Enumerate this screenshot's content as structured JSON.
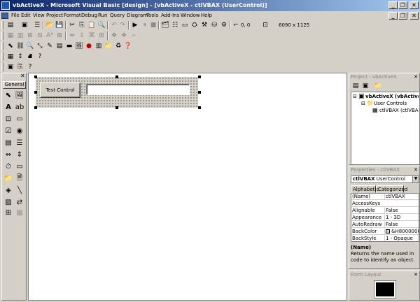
{
  "window": {
    "title": "vbActiveX - Microsoft Visual Basic [design] - [vbActiveX - ctlVBAX (UserControl)]",
    "minimize": "_",
    "restore": "❐",
    "close": "✕"
  },
  "menu": [
    "File",
    "Edit",
    "View",
    "Project",
    "Format",
    "Debug",
    "Run",
    "Query",
    "Diagram",
    "Tools",
    "Add-Ins",
    "Window",
    "Help"
  ],
  "toolbar": {
    "position": "0, 0",
    "size": "6090 x 1125"
  },
  "toolbox": {
    "tab": "General"
  },
  "design": {
    "button_label": "Test Control"
  },
  "project": {
    "title": "Project - vbActiveX",
    "root": "vbActiveX (vbActiveX.vbp)",
    "folder": "User Controls",
    "item": "ctlVBAX (ctlVBAX.ctl)"
  },
  "properties": {
    "title": "Properties - ctlVBAX",
    "object_name": "ctlVBAX",
    "object_type": "UserControl",
    "tabs": [
      "Alphabetic",
      "Categorized"
    ],
    "rows": [
      {
        "name": "(Name)",
        "value": "ctlVBAX"
      },
      {
        "name": "AccessKeys",
        "value": ""
      },
      {
        "name": "Alignable",
        "value": "False"
      },
      {
        "name": "Appearance",
        "value": "1 - 3D"
      },
      {
        "name": "AutoRedraw",
        "value": "False"
      },
      {
        "name": "BackColor",
        "value": "&H8000000"
      },
      {
        "name": "BackStyle",
        "value": "1 - Opaque"
      }
    ],
    "desc_title": "(Name)",
    "desc_text": "Returns the name used in code to identify an object."
  },
  "form_layout": {
    "title": "Form Layout"
  },
  "colors": {
    "titlebar_start": "#0a246a",
    "titlebar_end": "#a6caf0",
    "face": "#d4d0c8"
  }
}
